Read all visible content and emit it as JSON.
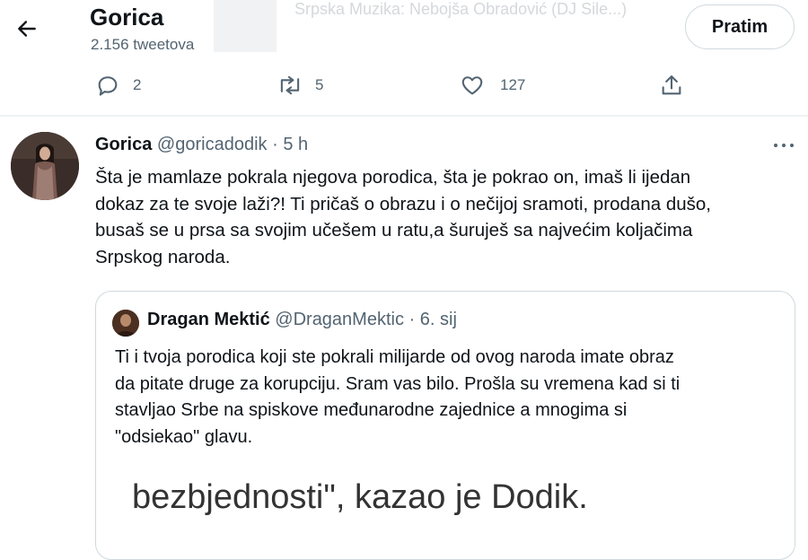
{
  "header": {
    "title": "Gorica",
    "tweet_count": "2.156 tweetova",
    "bg_text": "Srpska Muzika: Nebojša Obradović (DJ Sile...)",
    "follow_label": "Pratim"
  },
  "actions": {
    "replies": "2",
    "retweets": "5",
    "likes": "127"
  },
  "tweet": {
    "name": "Gorica",
    "handle": "@goricadodik",
    "sep": "·",
    "time": "5 h",
    "lines": [
      "Šta je mamlaze pokrala njegova porodica, šta je pokrao on, imaš li ijedan",
      "dokaz za te svoje laži?! Ti pričaš o obrazu i o nečijoj sramoti, prodana dušo,",
      "busaš se u prsa sa svojim učešem u ratu,a šuruješ sa najvećim koljačima",
      "Srpskog naroda."
    ]
  },
  "quote": {
    "name": "Dragan Mektić",
    "handle": "@DraganMektic",
    "sep": "·",
    "time": "6. sij",
    "lines": [
      "Ti i tvoja porodica koji ste pokrali milijarde od ovog naroda imate obraz",
      "da pitate druge za korupciju. Sram vas bilo. Prošla su vremena kad si ti",
      "stavljao Srbe na spiskove međunarodne zajednice a mnogima si",
      "\"odsiekao\" glavu."
    ],
    "media_caption": "bezbjednosti\", kazao je Dodik."
  },
  "icons": {
    "back": "arrow-left-icon",
    "reply": "reply-icon",
    "retweet": "retweet-icon",
    "like": "heart-icon",
    "share": "share-icon",
    "more": "more-icon"
  },
  "colors": {
    "text": "#0f1419",
    "muted": "#536471",
    "border": "#cfd9de"
  }
}
